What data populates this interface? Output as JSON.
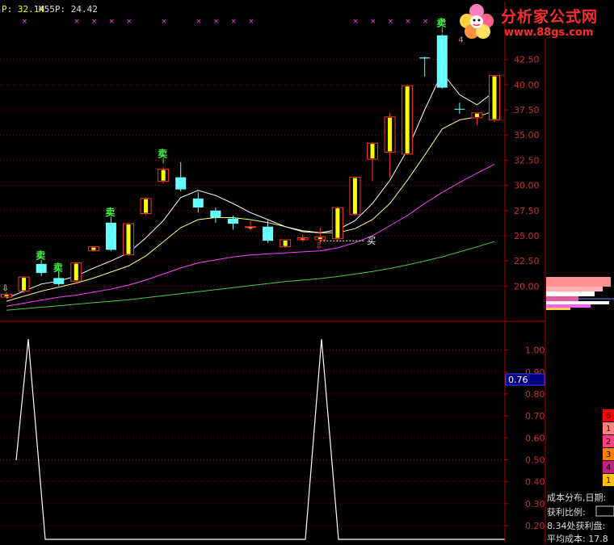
{
  "header": {
    "ma_label": "P:",
    "ma_value": "32.14",
    "m55_label": "M55P:",
    "m55_value": "24.42"
  },
  "watermark": {
    "brand_cn": "分析家公式网",
    "url": "www.88gs.com"
  },
  "colors": {
    "background": "#000000",
    "axis_red": "#b00000",
    "up_candle": "#ffff00",
    "down_candle": "#66ffff",
    "ma_white": "#ffffff",
    "ma_yellow": "#ffff80",
    "ma_magenta": "#ff40ff",
    "ma_green": "#40d040",
    "signal_green": "#40ff40",
    "signal_red": "#ff2020"
  },
  "signals": {
    "sell_glyph": "卖",
    "buy_glyph": "买",
    "buy_text": "买",
    "peak_text": "4"
  },
  "right_panel": {
    "lines": [
      "成本分布,日期:",
      "获利比例:",
      "8.34处获利盘:",
      "平均成本: 17.8"
    ],
    "legend": [
      {
        "color": "#ff0000",
        "text": "6"
      },
      {
        "color": "#ff8080",
        "text": "1"
      },
      {
        "color": "#ff4080",
        "text": "2"
      },
      {
        "color": "#ff8000",
        "text": "3"
      },
      {
        "color": "#c02080",
        "text": "4"
      },
      {
        "color": "#ffc000",
        "text": "1"
      }
    ]
  },
  "chart_data": [
    {
      "type": "candlestick",
      "title": "",
      "ylim": [
        16.5,
        46.0
      ],
      "y_ticks": [
        "42.50",
        "40.00",
        "37.50",
        "35.00",
        "32.50",
        "30.00",
        "27.50",
        "25.00",
        "22.50",
        "20.00"
      ],
      "candles": [
        {
          "o": 18.9,
          "c": 19.2,
          "h": 19.4,
          "l": 18.8,
          "up": true
        },
        {
          "o": 19.5,
          "c": 20.9,
          "h": 21.0,
          "l": 19.3,
          "up": true
        },
        {
          "o": 21.3,
          "c": 22.2,
          "h": 22.5,
          "l": 21.0,
          "up": false
        },
        {
          "o": 20.8,
          "c": 20.2,
          "h": 21.5,
          "l": 20.0,
          "up": false
        },
        {
          "o": 20.5,
          "c": 22.3,
          "h": 22.4,
          "l": 20.3,
          "up": true
        },
        {
          "o": 23.5,
          "c": 23.9,
          "h": 24.0,
          "l": 23.4,
          "up": true
        },
        {
          "o": 26.3,
          "c": 23.6,
          "h": 26.8,
          "l": 23.5,
          "up": false
        },
        {
          "o": 23.1,
          "c": 26.2,
          "h": 26.3,
          "l": 23.0,
          "up": true
        },
        {
          "o": 27.2,
          "c": 28.7,
          "h": 28.8,
          "l": 27.0,
          "up": true
        },
        {
          "o": 30.4,
          "c": 31.6,
          "h": 31.8,
          "l": 30.2,
          "up": true
        },
        {
          "o": 30.8,
          "c": 29.6,
          "h": 32.3,
          "l": 29.4,
          "up": false
        },
        {
          "o": 28.7,
          "c": 27.8,
          "h": 29.3,
          "l": 27.3,
          "up": false
        },
        {
          "o": 27.5,
          "c": 26.8,
          "h": 27.8,
          "l": 26.3,
          "up": false
        },
        {
          "o": 26.7,
          "c": 26.2,
          "h": 27.0,
          "l": 25.6,
          "up": false
        },
        {
          "o": 25.9,
          "c": 25.9,
          "h": 26.5,
          "l": 25.5,
          "up": true
        },
        {
          "o": 25.9,
          "c": 24.5,
          "h": 26.5,
          "l": 24.3,
          "up": false
        },
        {
          "o": 23.9,
          "c": 24.6,
          "h": 24.6,
          "l": 23.8,
          "up": true
        },
        {
          "o": 24.6,
          "c": 24.8,
          "h": 25.1,
          "l": 24.4,
          "up": true
        },
        {
          "o": 24.6,
          "c": 24.9,
          "h": 25.8,
          "l": 24.2,
          "up": true
        },
        {
          "o": 24.7,
          "c": 27.8,
          "h": 27.9,
          "l": 24.5,
          "up": true
        },
        {
          "o": 27.1,
          "c": 30.8,
          "h": 30.9,
          "l": 27.0,
          "up": true
        },
        {
          "o": 32.6,
          "c": 34.2,
          "h": 34.3,
          "l": 30.4,
          "up": true
        },
        {
          "o": 33.3,
          "c": 36.8,
          "h": 37.2,
          "l": 30.8,
          "up": true
        },
        {
          "o": 33.1,
          "c": 39.9,
          "h": 40.0,
          "l": 33.0,
          "up": true
        },
        {
          "o": 42.6,
          "c": 42.7,
          "h": 42.8,
          "l": 40.8,
          "up": false
        },
        {
          "o": 44.9,
          "c": 39.7,
          "h": 45.0,
          "l": 39.6,
          "up": false
        },
        {
          "o": 37.6,
          "c": 37.6,
          "h": 38.2,
          "l": 37.1,
          "up": false
        },
        {
          "o": 36.7,
          "c": 37.2,
          "h": 37.2,
          "l": 36.0,
          "up": true
        },
        {
          "o": 36.5,
          "c": 40.9,
          "h": 40.9,
          "l": 36.3,
          "up": true
        }
      ],
      "ma_white": [
        18.8,
        19.5,
        20.2,
        20.5,
        21.0,
        21.8,
        22.5,
        23.3,
        24.8,
        26.5,
        28.8,
        29.5,
        29.0,
        28.2,
        27.3,
        26.6,
        25.9,
        25.4,
        25.3,
        25.6,
        26.5,
        28.2,
        30.5,
        33.5,
        37.5,
        41.2,
        39.0,
        38.0,
        39.3
      ],
      "ma_yellow": [
        18.5,
        19.0,
        19.5,
        19.9,
        20.3,
        20.8,
        21.4,
        22.0,
        23.0,
        24.4,
        25.8,
        26.6,
        26.8,
        26.8,
        26.6,
        26.3,
        25.9,
        25.5,
        25.3,
        25.3,
        25.7,
        26.6,
        28.2,
        30.5,
        33.0,
        35.6,
        36.5,
        36.8,
        37.4
      ],
      "ma_magenta": [
        18.0,
        18.3,
        18.6,
        18.9,
        19.1,
        19.4,
        19.7,
        20.1,
        20.6,
        21.2,
        21.8,
        22.3,
        22.6,
        22.9,
        23.1,
        23.2,
        23.3,
        23.4,
        23.5,
        23.8,
        24.3,
        25.0,
        26.0,
        27.0,
        28.2,
        29.3,
        30.3,
        31.2,
        32.1
      ],
      "ma_green": [
        17.6,
        17.75,
        17.9,
        18.05,
        18.2,
        18.35,
        18.5,
        18.65,
        18.85,
        19.05,
        19.25,
        19.45,
        19.65,
        19.85,
        20.05,
        20.25,
        20.45,
        20.6,
        20.75,
        20.95,
        21.2,
        21.45,
        21.75,
        22.1,
        22.5,
        22.9,
        23.4,
        23.9,
        24.42
      ],
      "sell_signals": [
        {
          "i": 2,
          "y": 22.7
        },
        {
          "i": 3,
          "y": 21.5
        },
        {
          "i": 6,
          "y": 27.0
        },
        {
          "i": 9,
          "y": 32.8
        },
        {
          "i": 25,
          "y": 45.8
        }
      ],
      "buy_signals": [
        {
          "i": 0,
          "y": 19.5
        },
        {
          "i": 18,
          "y": 23.7
        }
      ],
      "buy_line_y": 24.5,
      "top_markers": [
        1,
        4,
        5,
        6,
        7,
        9,
        11,
        12,
        13,
        14,
        20,
        21,
        22,
        23,
        24,
        25
      ]
    },
    {
      "type": "line",
      "title": "",
      "ylim": [
        0.13,
        1.05
      ],
      "y_ticks": [
        "1.00",
        "0.90",
        "0.80",
        "0.70",
        "0.60",
        "0.50",
        "0.40",
        "0.30",
        "0.20"
      ],
      "current_label": "0.76",
      "x": [
        0,
        1,
        2,
        3,
        4,
        5,
        6,
        7,
        8,
        9,
        10,
        11,
        12,
        13,
        14,
        15,
        16,
        17,
        18,
        19,
        20,
        21,
        22,
        23,
        24,
        25,
        26,
        27,
        28
      ],
      "y": [
        0.0,
        1.0,
        0.0,
        0.0,
        0.0,
        0.0,
        0.0,
        0.0,
        0.0,
        0.0,
        0.0,
        0.0,
        0.0,
        0.0,
        0.0,
        0.0,
        0.0,
        1.0,
        0.0,
        0.0,
        0.0,
        0.0,
        0.0,
        0.0,
        0.0,
        0.0,
        0.0,
        0.0,
        0.0
      ]
    }
  ]
}
